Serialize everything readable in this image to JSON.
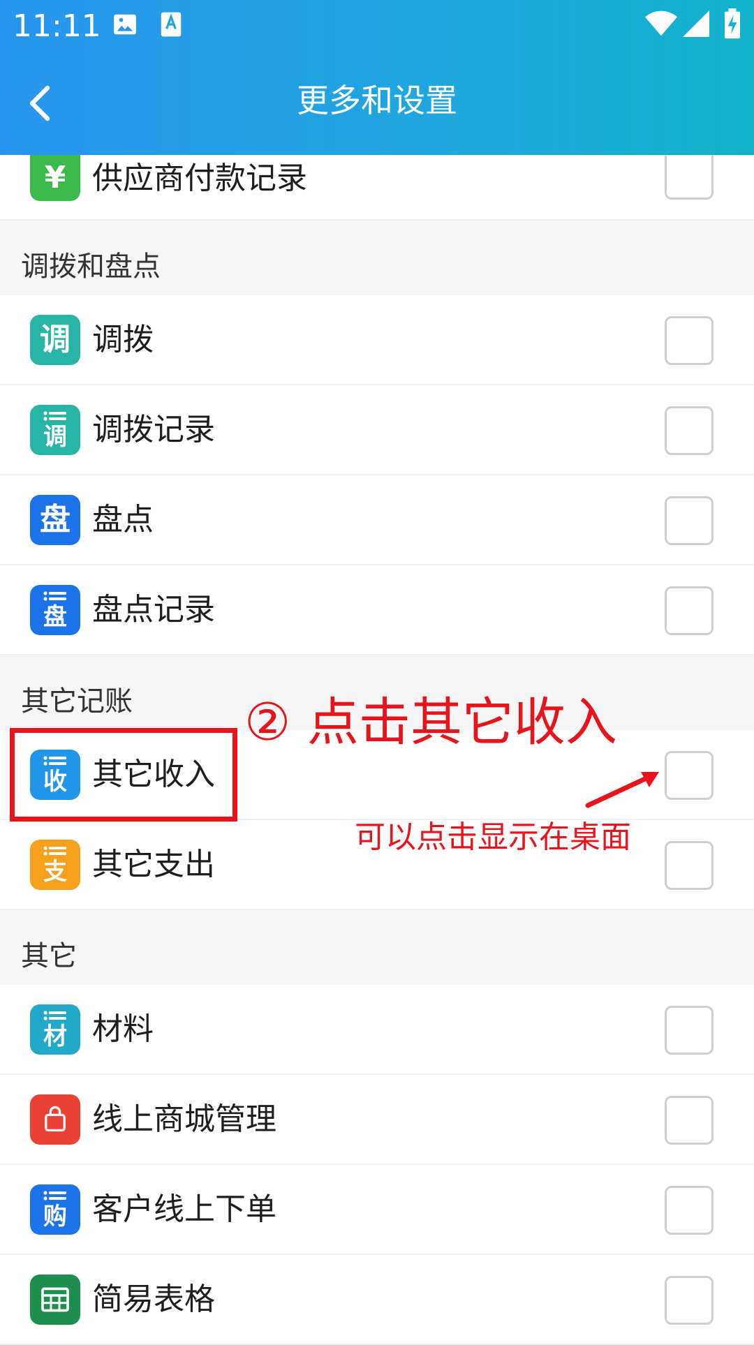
{
  "status_bar": {
    "time": "11:11"
  },
  "header": {
    "title": "更多和设置"
  },
  "partial_item": {
    "label": "供应商付款记录",
    "icon_char": "¥",
    "icon_color": "#3dba4e"
  },
  "sections": [
    {
      "label": "调拨和盘点",
      "items": [
        {
          "label": "调拨",
          "icon_char": "调",
          "icon_style": "char",
          "icon_color": "#26b5a6"
        },
        {
          "label": "调拨记录",
          "icon_char": "调",
          "icon_style": "list",
          "icon_color": "#26b5a6"
        },
        {
          "label": "盘点",
          "icon_char": "盘",
          "icon_style": "char",
          "icon_color": "#1a73e8"
        },
        {
          "label": "盘点记录",
          "icon_char": "盘",
          "icon_style": "list",
          "icon_color": "#1a73e8"
        }
      ]
    },
    {
      "label": "其它记账",
      "items": [
        {
          "label": "其它收入",
          "icon_char": "收",
          "icon_style": "list",
          "icon_color": "#2196e8"
        },
        {
          "label": "其它支出",
          "icon_char": "支",
          "icon_style": "list",
          "icon_color": "#f7a01c"
        }
      ]
    },
    {
      "label": "其它",
      "items": [
        {
          "label": "材料",
          "icon_char": "材",
          "icon_style": "list",
          "icon_color": "#20a9c9"
        },
        {
          "label": "线上商城管理",
          "icon_char": "",
          "icon_style": "bag",
          "icon_color": "#ea4335"
        },
        {
          "label": "客户线上下单",
          "icon_char": "购",
          "icon_style": "list",
          "icon_color": "#1a73e8"
        },
        {
          "label": "简易表格",
          "icon_char": "",
          "icon_style": "table",
          "icon_color": "#1e8e4e"
        }
      ]
    }
  ],
  "annotations": {
    "step": "② 点击其它收入",
    "hint": "可以点击显示在桌面",
    "color": "#e8141b"
  }
}
